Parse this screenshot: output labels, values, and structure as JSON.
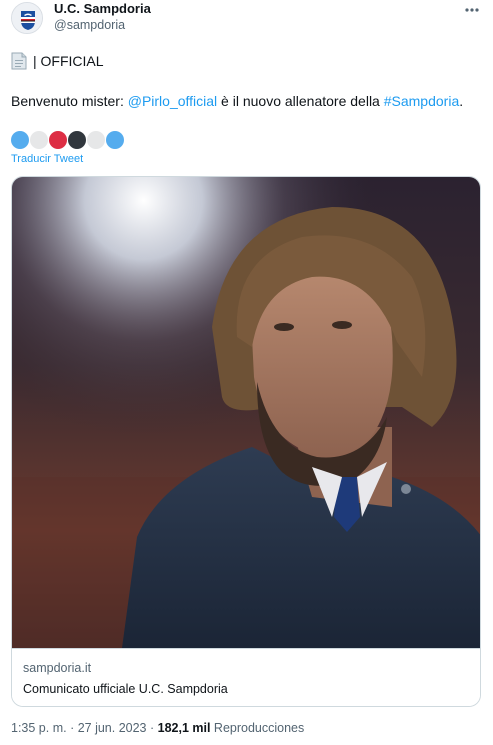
{
  "account": {
    "name": "U.C. Sampdoria",
    "handle": "@sampdoria",
    "avatar_icon": "sampdoria-crest-icon",
    "more_icon": "more-dots-icon"
  },
  "tweet": {
    "doc_icon": "page-facing-up-icon",
    "official_label": "| OFFICIAL",
    "text_prefix": "Benvenuto mister: ",
    "mention": "@Pirlo_official",
    "text_middle": " è il nuovo allenatore della ",
    "hashtag": "#Sampdoria",
    "text_suffix": ".",
    "emoji_dots": [
      "#55acee",
      "#e6e7e8",
      "#dd2e44",
      "#31373d",
      "#e6e7e8",
      "#55acee"
    ],
    "translate_label": "Traducir Tweet"
  },
  "card": {
    "domain": "sampdoria.it",
    "title": "Comunicato ufficiale U.C. Sampdoria"
  },
  "footer": {
    "time": "1:35 p. m.",
    "separator1": " · ",
    "date": "27 jun. 2023",
    "separator2": " · ",
    "views_count": "182,1 mil",
    "views_label": " Reproducciones"
  },
  "colors": {
    "link": "#1d9bf0",
    "secondary_text": "#536471",
    "border": "#cfd9de"
  }
}
